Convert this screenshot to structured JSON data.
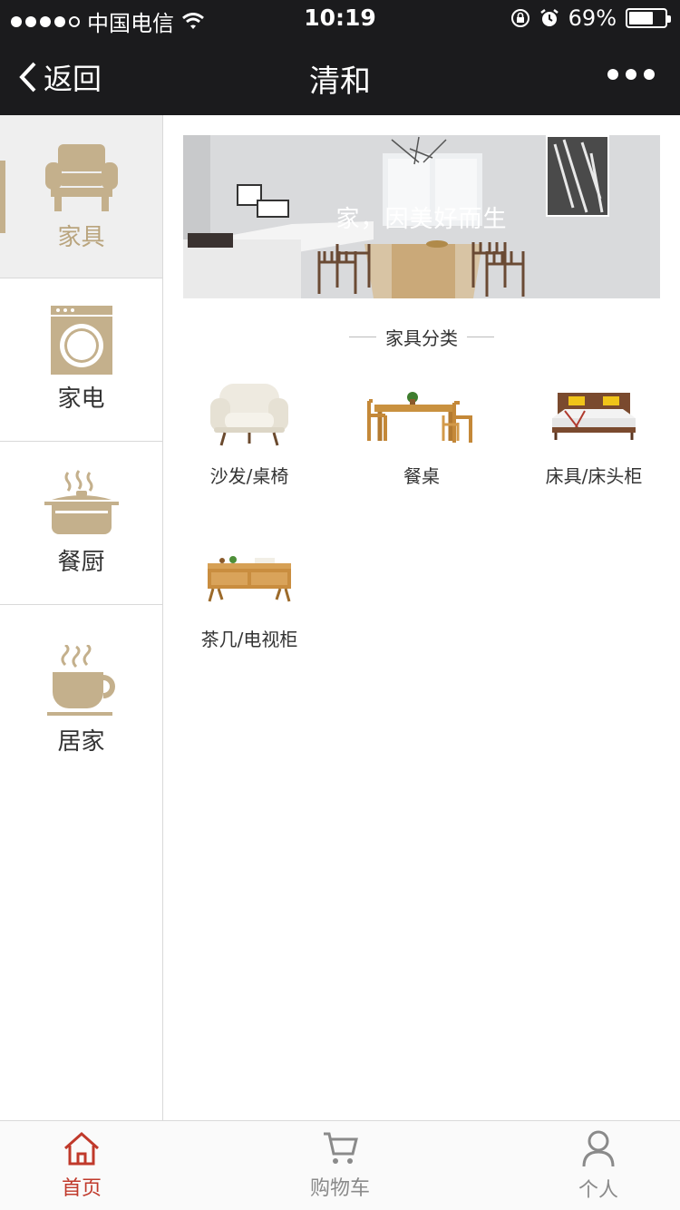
{
  "status_bar": {
    "carrier": "中国电信",
    "time": "10:19",
    "battery": "69%",
    "battery_level": 0.69
  },
  "nav": {
    "back_label": "返回",
    "title": "清和"
  },
  "sidebar": {
    "items": [
      {
        "label": "家具",
        "icon": "armchair-icon",
        "active": true
      },
      {
        "label": "家电",
        "icon": "washing-machine-icon",
        "active": false
      },
      {
        "label": "餐厨",
        "icon": "cooking-pot-icon",
        "active": false
      },
      {
        "label": "居家",
        "icon": "coffee-cup-icon",
        "active": false
      }
    ]
  },
  "banner": {
    "text": "家，因美好而生"
  },
  "section": {
    "title": "家具分类"
  },
  "categories": [
    {
      "label": "沙发/桌椅",
      "icon": "sofa-image"
    },
    {
      "label": "餐桌",
      "icon": "dining-table-image"
    },
    {
      "label": "床具/床头柜",
      "icon": "bed-image"
    },
    {
      "label": "茶几/电视柜",
      "icon": "tv-cabinet-image"
    }
  ],
  "tabs": [
    {
      "label": "首页",
      "icon": "home-icon",
      "active": true
    },
    {
      "label": "购物车",
      "icon": "cart-icon",
      "active": false
    },
    {
      "label": "个人",
      "icon": "user-icon",
      "active": false
    }
  ],
  "colors": {
    "accent": "#c4b08c",
    "tab_active": "#c0392b",
    "header_bg": "#1b1b1d"
  }
}
